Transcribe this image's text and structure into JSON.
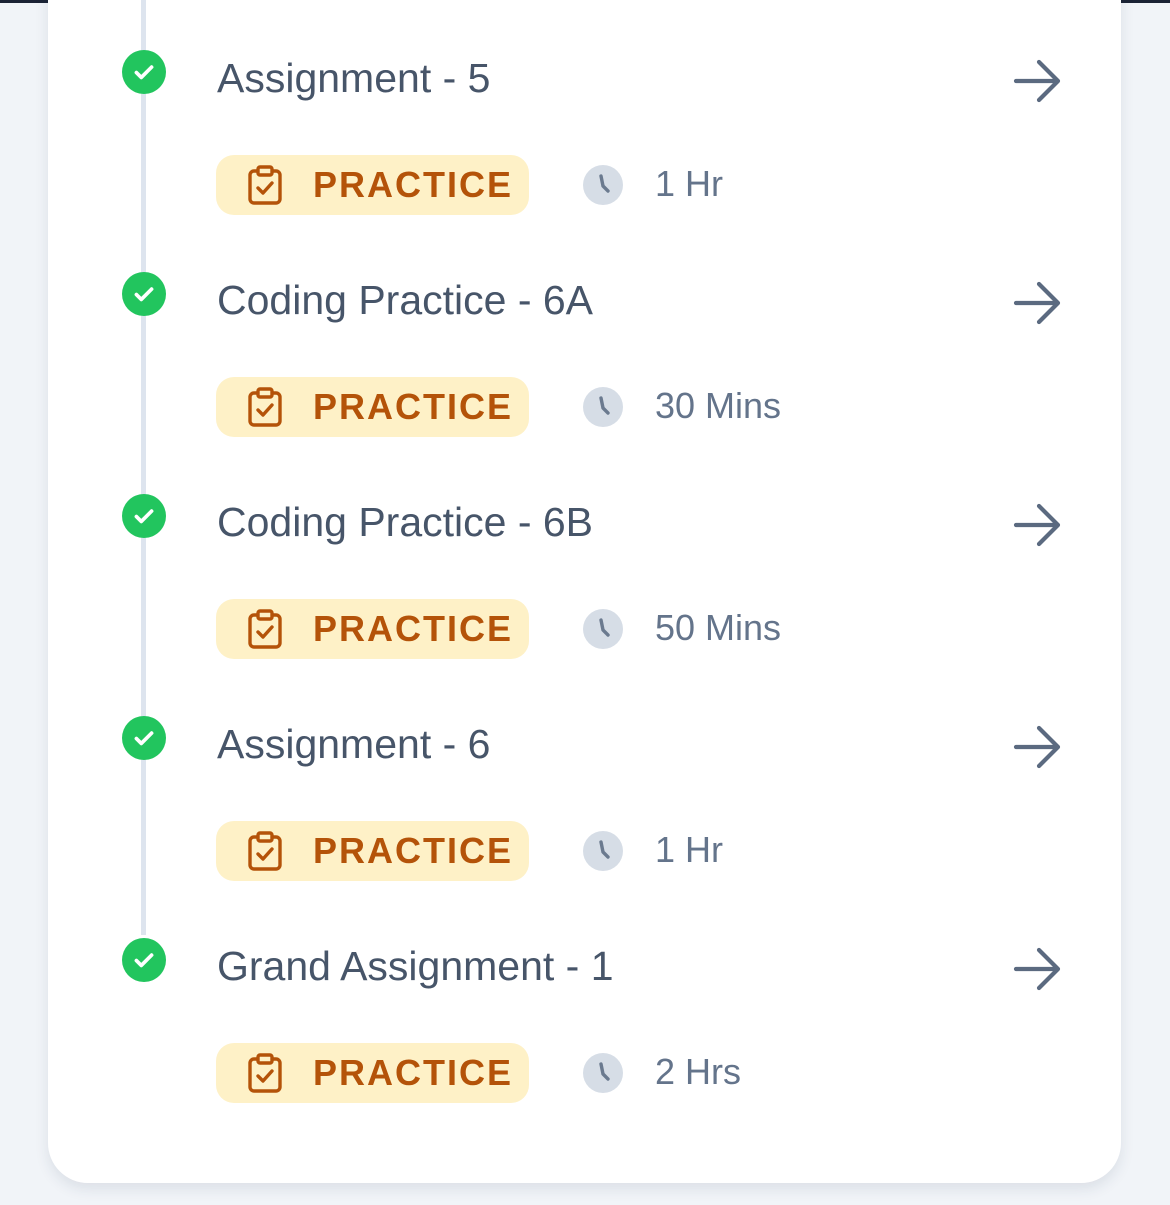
{
  "colors": {
    "check": "#22c55e",
    "badge_bg": "#fef1c7",
    "badge_text": "#b45309",
    "title": "#475569",
    "duration": "#64748b"
  },
  "items": [
    {
      "title": "Assignment - 5",
      "badge": "PRACTICE",
      "duration": "1 Hr",
      "status_icon": "check-circle-icon",
      "action_icon": "arrow-right-icon"
    },
    {
      "title": "Coding Practice - 6A",
      "badge": "PRACTICE",
      "duration": "30 Mins",
      "status_icon": "check-circle-icon",
      "action_icon": "arrow-right-icon"
    },
    {
      "title": "Coding Practice - 6B",
      "badge": "PRACTICE",
      "duration": "50 Mins",
      "status_icon": "check-circle-icon",
      "action_icon": "arrow-right-icon"
    },
    {
      "title": "Assignment - 6",
      "badge": "PRACTICE",
      "duration": "1 Hr",
      "status_icon": "check-circle-icon",
      "action_icon": "arrow-right-icon"
    },
    {
      "title": "Grand Assignment - 1",
      "badge": "PRACTICE",
      "duration": "2 Hrs",
      "status_icon": "check-circle-icon",
      "action_icon": "arrow-right-icon"
    }
  ]
}
